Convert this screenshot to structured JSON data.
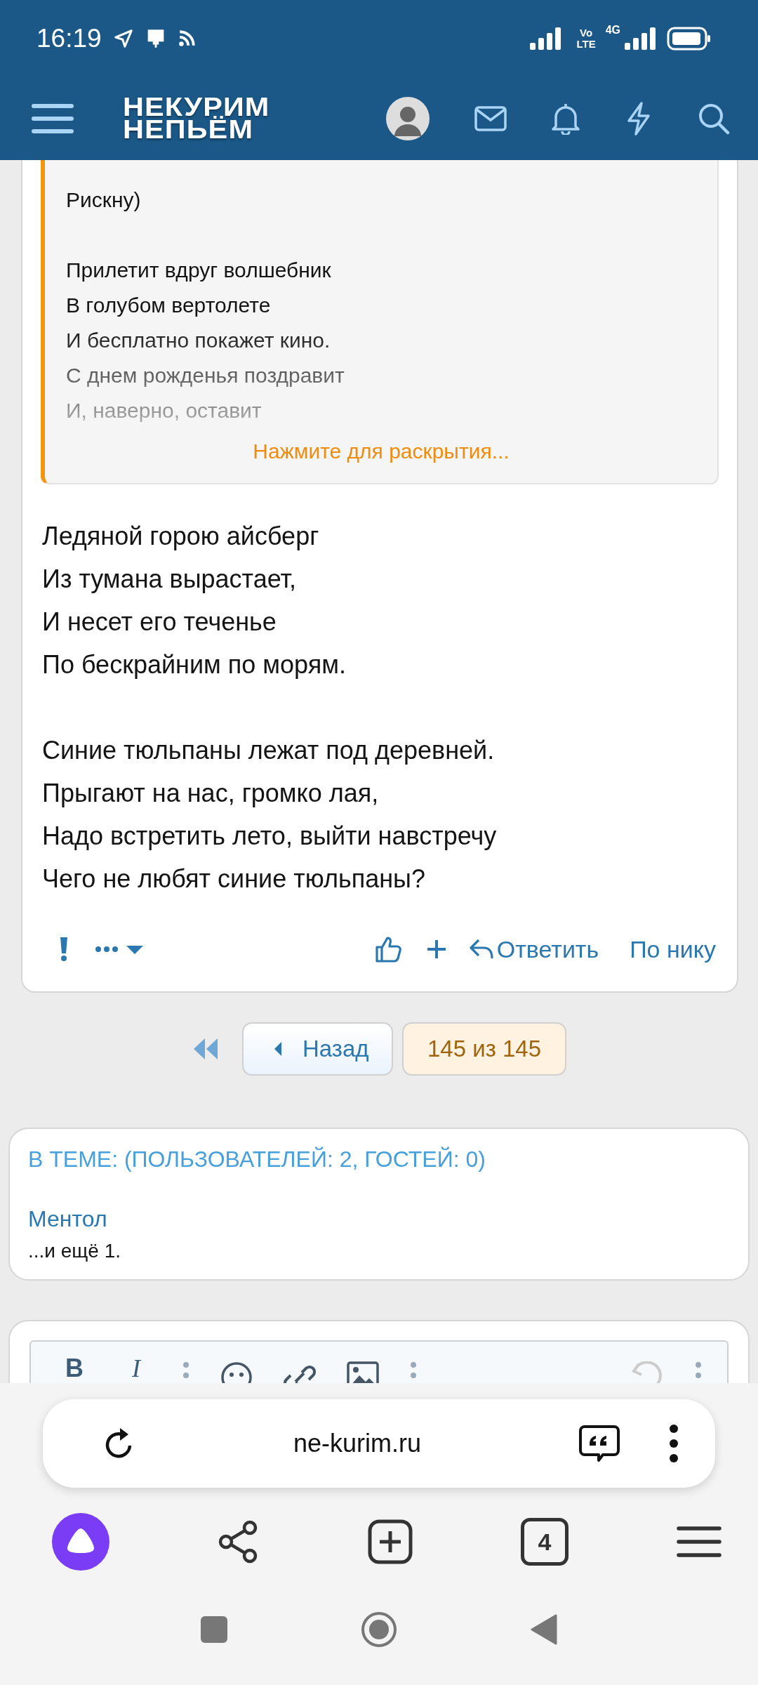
{
  "status_bar": {
    "time": "16:19",
    "volte": [
      "Vo",
      "LTE"
    ],
    "network": "4G"
  },
  "header": {
    "logo": [
      "НЕКУРИМ",
      "НЕПЬЁМ"
    ]
  },
  "post": {
    "quote": {
      "paragraphs": [
        [
          "Рискну)"
        ],
        [
          "Прилетит вдруг волшебник",
          "В голубом вертолете",
          "И бесплатно покажет кино.",
          "С днем рожденья поздравит",
          "И, наверно, оставит"
        ]
      ],
      "expand_link": "Нажмите для раскрытия..."
    },
    "body": [
      [
        "Ледяной горою айсберг",
        "Из тумана вырастает,",
        "И несет его теченье",
        "По бескрайним по морям."
      ],
      [
        "Синие тюльпаны лежат под деревней.",
        "Прыгают на нас, громко лая,",
        "Надо встретить лето, выйти навстречу",
        "Чего не любят синие тюльпаны?"
      ]
    ],
    "reply": "Ответить",
    "by_nick": "По нику"
  },
  "pagination": {
    "back": "Назад",
    "current": "145 из 145"
  },
  "online": {
    "title": "В ТЕМЕ: (ПОЛЬЗОВАТЕЛЕЙ: 2, ГОСТЕЙ: 0)",
    "users": [
      "Ментол"
    ],
    "more": "...и ещё 1."
  },
  "editor": {
    "toolbar": [
      {
        "kind": "bold",
        "label": "B"
      },
      {
        "kind": "italic",
        "label": "I"
      }
    ]
  },
  "browser": {
    "url": "ne-kurim.ru",
    "tab_count": "4"
  }
}
